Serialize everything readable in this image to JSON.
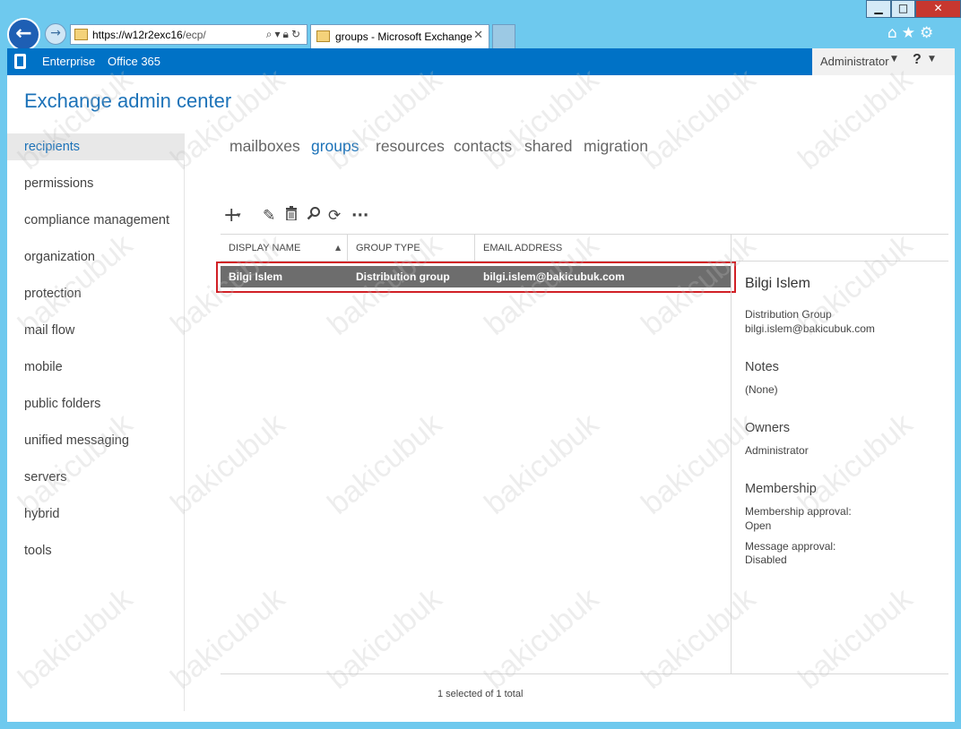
{
  "browser": {
    "address_host": "https://w12r2exc16",
    "address_path": "/ecp/",
    "tab_title": "groups - Microsoft Exchange",
    "tab_close": "✕",
    "window_buttons": {
      "minimize": "▁",
      "maximize": "□",
      "close": "✕"
    },
    "icons": [
      "home-icon",
      "favorites-star-icon",
      "settings-gear-icon"
    ]
  },
  "o365bar": {
    "enterprise": "Enterprise",
    "office365": "Office 365",
    "user": "Administrator",
    "help": "?"
  },
  "app_title": "Exchange admin center",
  "leftnav": [
    {
      "label": "recipients",
      "selected": true
    },
    {
      "label": "permissions"
    },
    {
      "label": "compliance management"
    },
    {
      "label": "organization"
    },
    {
      "label": "protection"
    },
    {
      "label": "mail flow"
    },
    {
      "label": "mobile"
    },
    {
      "label": "public folders"
    },
    {
      "label": "unified messaging"
    },
    {
      "label": "servers"
    },
    {
      "label": "hybrid"
    },
    {
      "label": "tools"
    }
  ],
  "tabs": [
    {
      "label": "mailboxes"
    },
    {
      "label": "groups",
      "active": true
    },
    {
      "label": "resources"
    },
    {
      "label": "contacts"
    },
    {
      "label": "shared"
    },
    {
      "label": "migration"
    }
  ],
  "toolbar": {
    "icons": [
      "add-icon",
      "edit-icon",
      "delete-icon",
      "search-icon",
      "refresh-icon",
      "more-icon"
    ]
  },
  "grid": {
    "columns": [
      "DISPLAY NAME",
      "GROUP TYPE",
      "EMAIL ADDRESS"
    ],
    "rows": [
      {
        "name": "Bilgi Islem",
        "type": "Distribution group",
        "email": "bilgi.islem@bakicubuk.com",
        "selected": true
      }
    ],
    "status": "1 selected of 1 total"
  },
  "details": {
    "title": "Bilgi Islem",
    "group_type": "Distribution Group",
    "email": "bilgi.islem@bakicubuk.com",
    "notes_heading": "Notes",
    "notes_value": "(None)",
    "owners_heading": "Owners",
    "owners_value": "Administrator",
    "membership_heading": "Membership",
    "membership_approval_label": "Membership approval:",
    "membership_approval_value": "Open",
    "message_approval_label": "Message approval:",
    "message_approval_value": "Disabled"
  },
  "watermark": "bakicubuk",
  "colors": {
    "o365_bar": "#0072c6",
    "accent": "#1c72b8",
    "selected_row": "#6d6d6d",
    "highlight_outline": "#d12026"
  }
}
